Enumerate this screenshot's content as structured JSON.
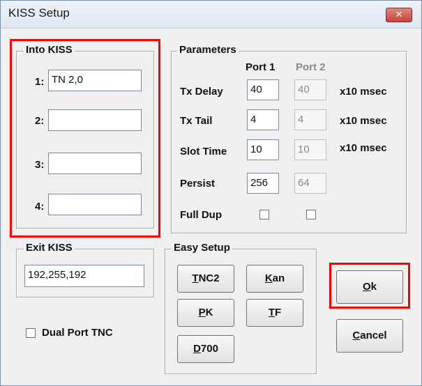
{
  "window": {
    "title": "KISS Setup",
    "close_glyph": "✕"
  },
  "into_kiss": {
    "legend": "Into KISS",
    "rows": [
      {
        "label": "1:",
        "value": "TN 2,0"
      },
      {
        "label": "2:",
        "value": ""
      },
      {
        "label": "3:",
        "value": ""
      },
      {
        "label": "4:",
        "value": ""
      }
    ]
  },
  "parameters": {
    "legend": "Parameters",
    "port1_header": "Port 1",
    "port2_header": "Port 2",
    "tx_delay": {
      "label": "Tx Delay",
      "port1": "40",
      "port2": "40",
      "unit": "x10 msec"
    },
    "tx_tail": {
      "label": "Tx Tail",
      "port1": "4",
      "port2": "4",
      "unit": "x10 msec"
    },
    "slot_time": {
      "label": "Slot Time",
      "port1": "10",
      "port2": "10",
      "unit": "x10 msec"
    },
    "persist": {
      "label": "Persist",
      "port1": "256",
      "port2": "64"
    },
    "full_dup": {
      "label": "Full Dup",
      "port1_checked": false,
      "port2_checked": false
    }
  },
  "exit_kiss": {
    "legend": "Exit KISS",
    "value": "192,255,192"
  },
  "easy_setup": {
    "legend": "Easy Setup",
    "buttons": [
      {
        "key": "T",
        "rest": "NC2"
      },
      {
        "key": "K",
        "rest": "an"
      },
      {
        "key": "P",
        "rest": "K"
      },
      {
        "key": "T",
        "rest": "F"
      },
      {
        "key": "D",
        "rest": "700"
      }
    ]
  },
  "dual_port": {
    "label": "Dual Port TNC",
    "checked": false
  },
  "ok_button": {
    "key": "O",
    "rest": "k"
  },
  "cancel_button": {
    "key": "C",
    "rest": "ancel"
  },
  "colors": {
    "highlight": "#ff0000",
    "close_button": "#c8443a"
  }
}
